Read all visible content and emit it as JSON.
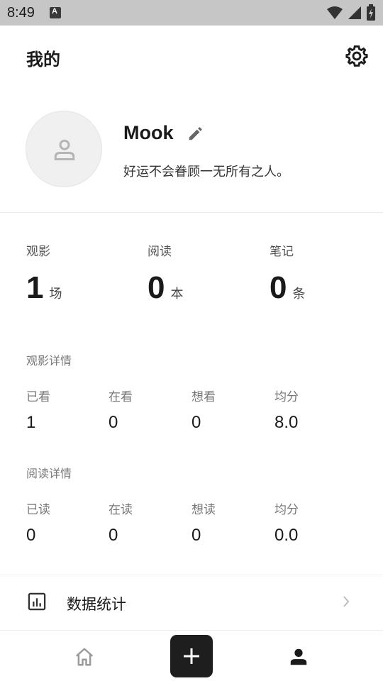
{
  "status_bar": {
    "time": "8:49",
    "icons": [
      "notification-a-icon",
      "wifi-icon",
      "signal-icon",
      "battery-icon"
    ]
  },
  "header": {
    "title": "我的",
    "settings_icon": "gear-icon"
  },
  "profile": {
    "avatar_icon": "user-placeholder-icon",
    "name": "Mook",
    "edit_icon": "pencil-icon",
    "motto": "好运不会眷顾一无所有之人。"
  },
  "summary": [
    {
      "label": "观影",
      "value": "1",
      "unit": "场"
    },
    {
      "label": "阅读",
      "value": "0",
      "unit": "本"
    },
    {
      "label": "笔记",
      "value": "0",
      "unit": "条"
    }
  ],
  "movie_details": {
    "title": "观影详情",
    "items": [
      {
        "label": "已看",
        "value": "1"
      },
      {
        "label": "在看",
        "value": "0"
      },
      {
        "label": "想看",
        "value": "0"
      },
      {
        "label": "均分",
        "value": "8.0"
      }
    ]
  },
  "reading_details": {
    "title": "阅读详情",
    "items": [
      {
        "label": "已读",
        "value": "0"
      },
      {
        "label": "在读",
        "value": "0"
      },
      {
        "label": "想读",
        "value": "0"
      },
      {
        "label": "均分",
        "value": "0.0"
      }
    ]
  },
  "menu": {
    "stats_label": "数据统计",
    "stats_icon": "bar-chart-icon",
    "chevron_icon": "chevron-right-icon"
  },
  "bottom_nav": {
    "items": [
      "home-icon",
      "add-icon",
      "profile-icon"
    ],
    "active": "profile-icon"
  },
  "colors": {
    "status_bar_bg": "#c6c6c6",
    "primary_text": "#1a1a1a",
    "secondary_text": "#777777",
    "add_button_bg": "#1e1e1e"
  }
}
